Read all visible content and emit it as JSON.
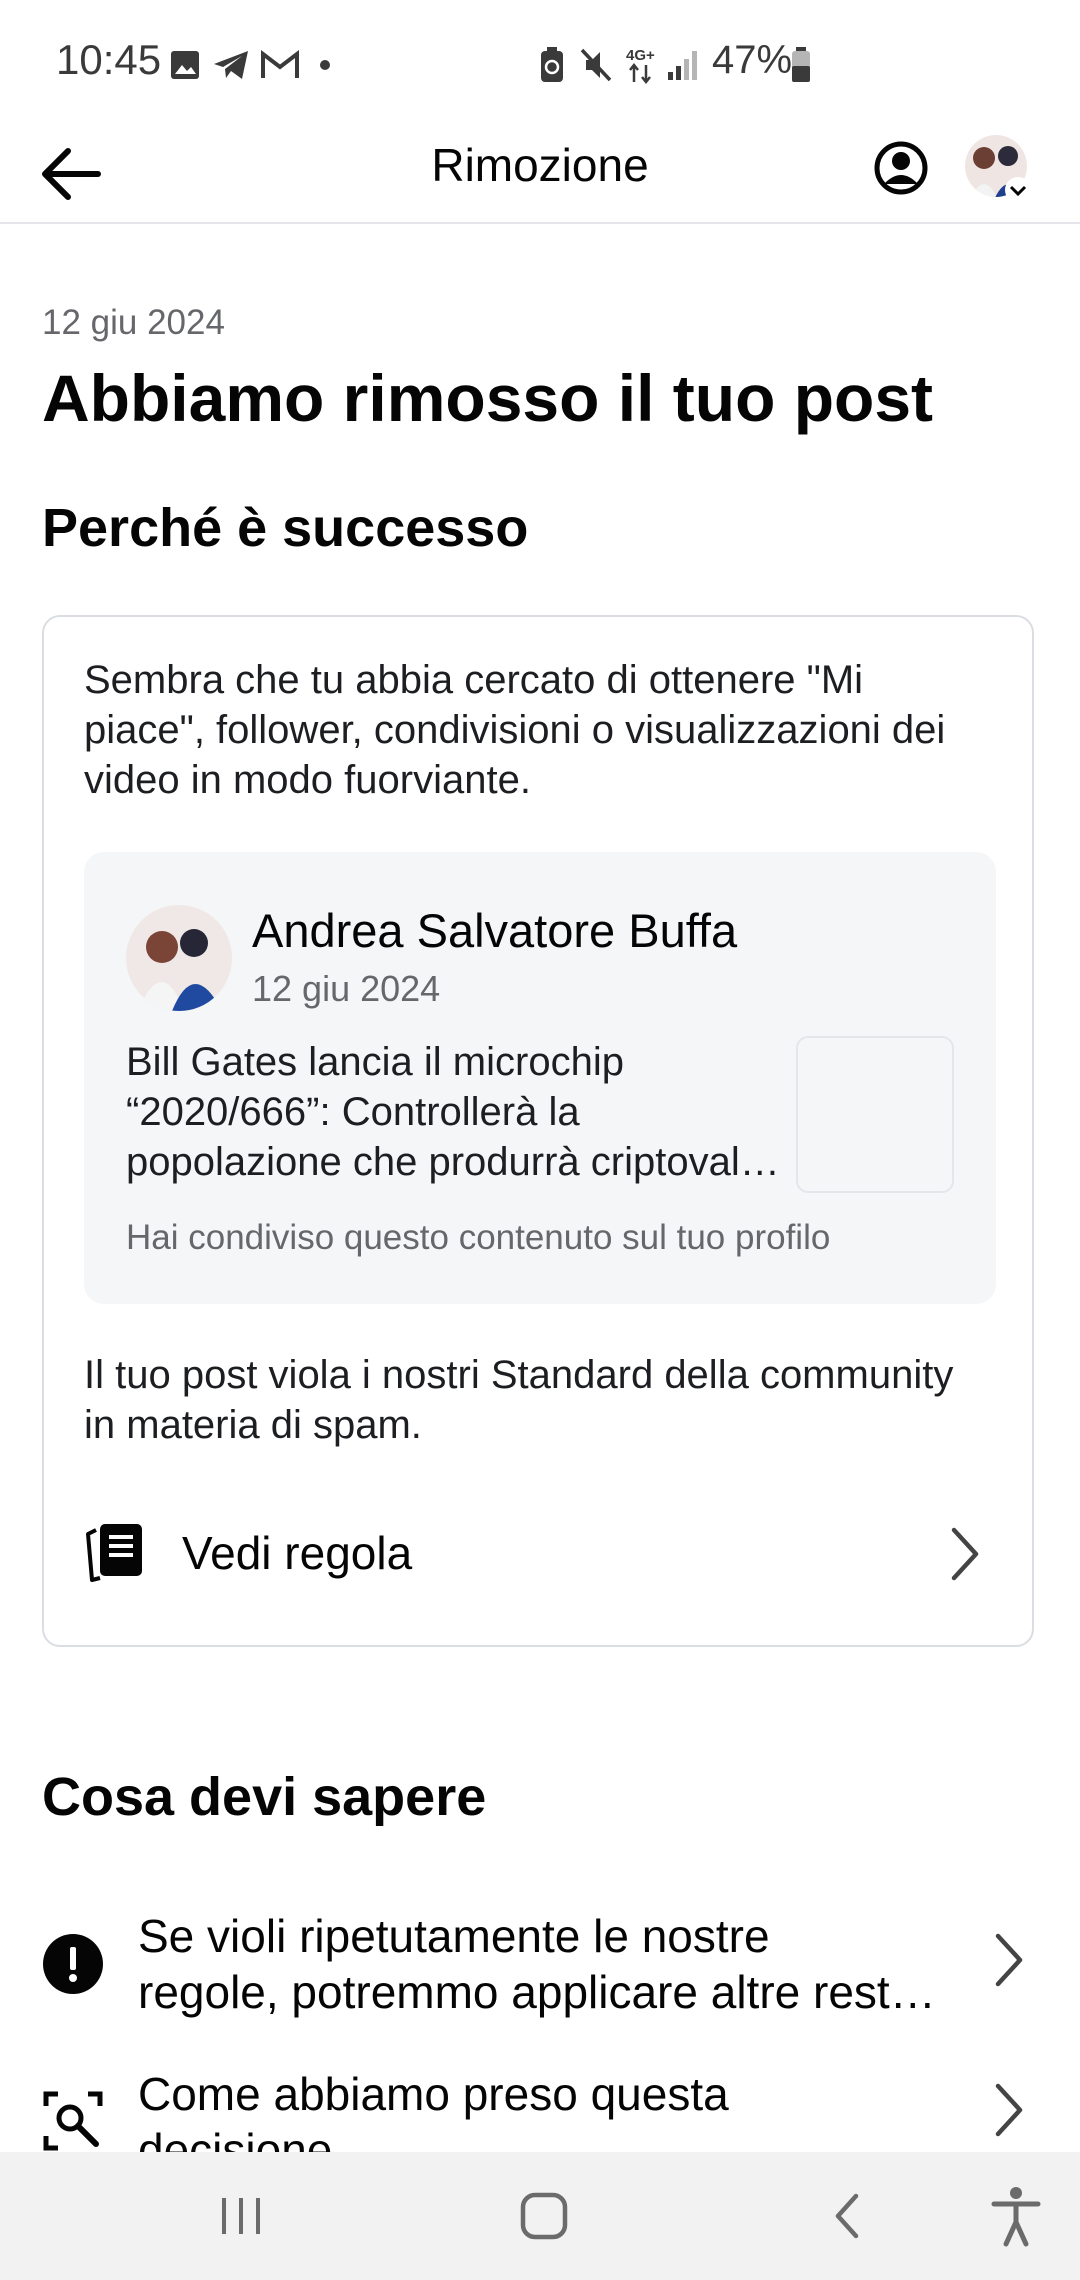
{
  "status_bar": {
    "time": "10:45",
    "battery": "47%",
    "left_icons": [
      "image-icon",
      "telegram-icon",
      "gmail-icon",
      "dot-icon"
    ],
    "right_icons": [
      "battery-saver-icon",
      "mute-icon",
      "4g-icon",
      "signal-icon",
      "battery-icon"
    ]
  },
  "header": {
    "title": "Rimozione",
    "back_icon": "arrow-left-icon",
    "account_icon": "account-circle-icon"
  },
  "main": {
    "date": "12 giu 2024",
    "title": "Abbiamo rimosso il tuo post",
    "why_heading": "Perché è successo",
    "reason_text": "Sembra che tu abbia cercato di ottenere \"Mi piace\", follower, condivisioni o visualizzazioni dei video in modo fuorviante.",
    "post": {
      "author": "Andrea Salvatore Buffa",
      "date": "12 giu 2024",
      "text_lines": [
        "Bill Gates lancia il microchip",
        "“2020/666”: Controllerà la",
        "popolazione che produrrà criptovalute"
      ],
      "shared_note": "Hai condiviso questo contenuto sul tuo profilo"
    },
    "violation_text": "Il tuo post viola i nostri Standard della community in materia di spam.",
    "rule_link": "Vedi regola",
    "know_heading": "Cosa devi sapere",
    "know_items": [
      {
        "icon": "alert-circle-icon",
        "lines": [
          "Se violi ripetutamente le nostre",
          "regole, potremmo applicare altre restrizioni"
        ]
      },
      {
        "icon": "search-scan-icon",
        "lines": [
          "Come abbiamo preso questa",
          "decisione"
        ]
      }
    ]
  },
  "nav_bar": {
    "icons": [
      "recent-apps-icon",
      "home-icon",
      "back-icon",
      "accessibility-icon"
    ]
  },
  "colors": {
    "text": "#050505",
    "secondary_text": "#65676b",
    "card_border": "#dadde1",
    "post_background": "#f5f6f7",
    "nav_background": "#f2f2f2"
  }
}
